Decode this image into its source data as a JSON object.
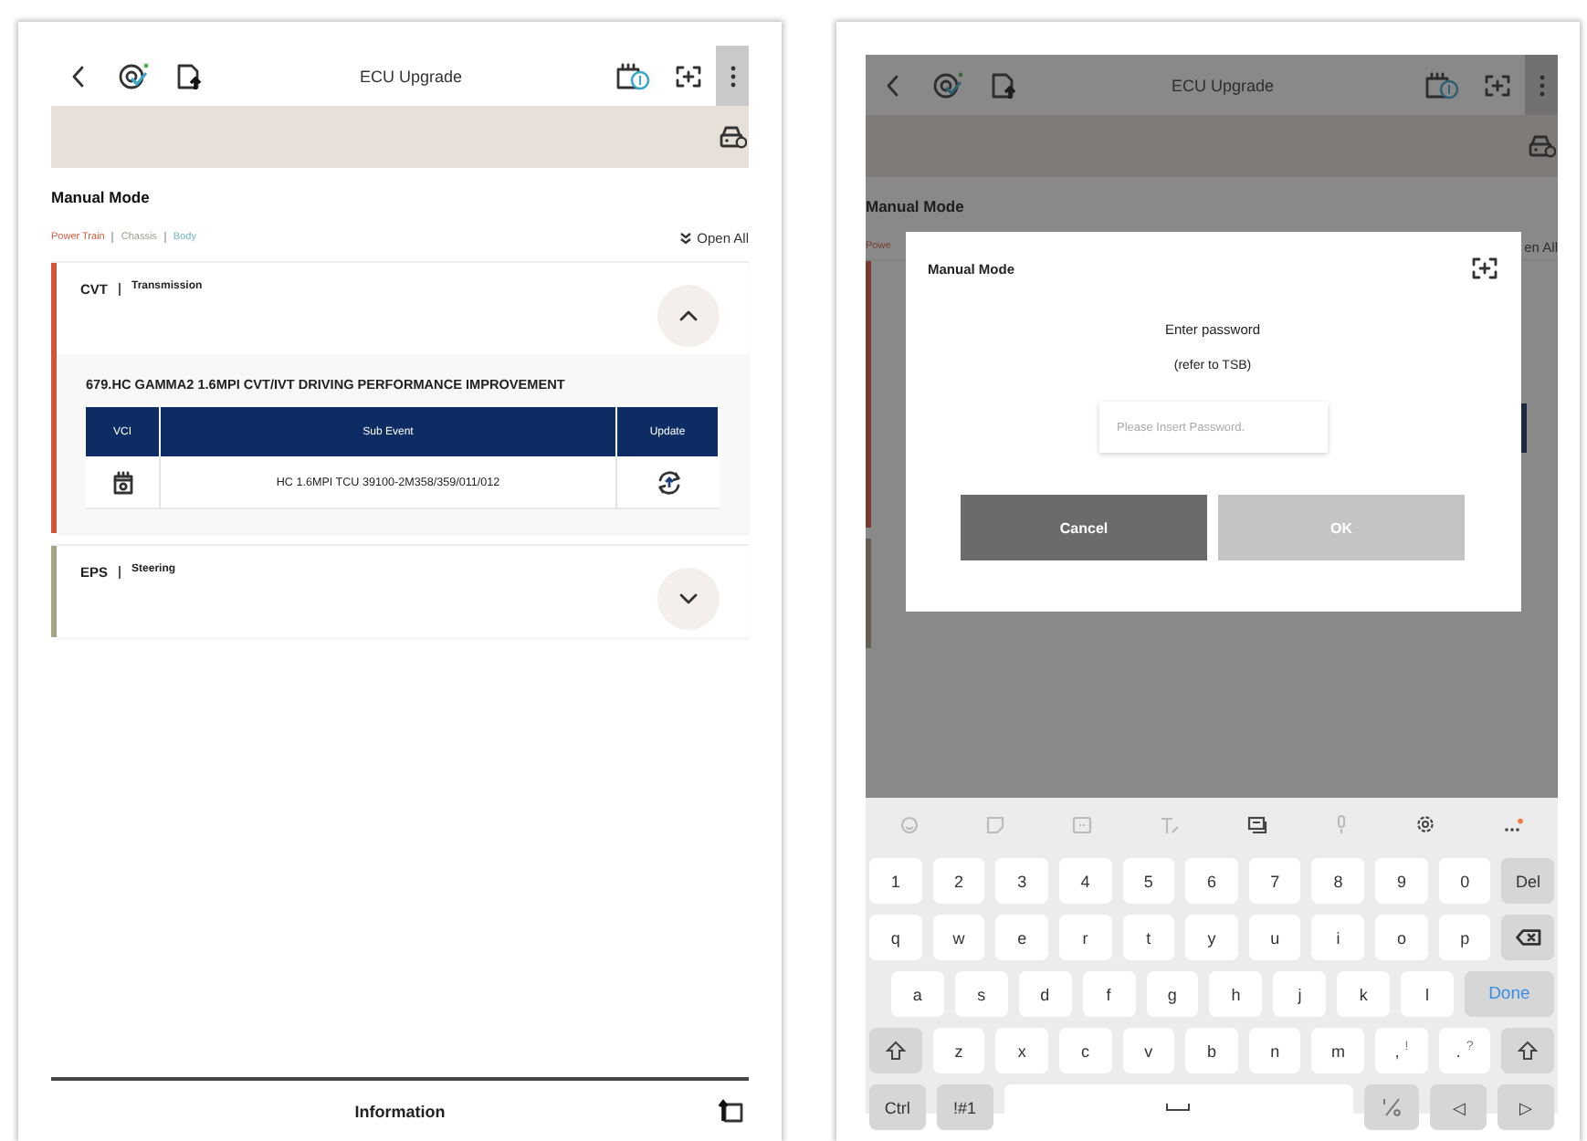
{
  "left_screen": {
    "header": {
      "title": "ECU Upgrade"
    },
    "page_title": "Manual Mode",
    "filters": [
      {
        "label": "Power Train",
        "color": "#d9593b"
      },
      {
        "label": "Chassis",
        "color": "#9c9f8c"
      },
      {
        "label": "Body",
        "color": "#79b6c6"
      }
    ],
    "open_all": "Open All",
    "groups": [
      {
        "code": "CVT",
        "name": "Transmission",
        "color": "#d4553a",
        "expanded": true,
        "event_title": "679.HC GAMMA2 1.6MPI CVT/IVT DRIVING PERFORMANCE IMPROVEMENT",
        "table": {
          "columns": [
            "VCI",
            "Sub Event",
            "Update"
          ],
          "rows": [
            {
              "sub_event": "HC 1.6MPI TCU 39100-2M358/359/011/012"
            }
          ]
        }
      },
      {
        "code": "EPS",
        "name": "Steering",
        "color": "#a6a485",
        "expanded": false
      }
    ],
    "footer": {
      "label": "Information"
    }
  },
  "right_screen": {
    "header": {
      "title": "ECU Upgrade"
    },
    "page_title": "Manual Mode",
    "filter_visible": "Powe",
    "open_all_visible": "en All",
    "dialog": {
      "title": "Manual Mode",
      "message": "Enter password",
      "note": "(refer to TSB)",
      "password": {
        "placeholder": "Please Insert Password."
      },
      "buttons": [
        {
          "label": "Cancel",
          "kind": "cancel",
          "disabled": false
        },
        {
          "label": "OK",
          "kind": "ok",
          "disabled": true
        }
      ]
    },
    "keyboard": {
      "rows": [
        {
          "keys": [
            {
              "label": "1",
              "kind": "char"
            },
            {
              "label": "2",
              "kind": "char"
            },
            {
              "label": "3",
              "kind": "char"
            },
            {
              "label": "4",
              "kind": "char"
            },
            {
              "label": "5",
              "kind": "char"
            },
            {
              "label": "6",
              "kind": "char"
            },
            {
              "label": "7",
              "kind": "char"
            },
            {
              "label": "8",
              "kind": "char"
            },
            {
              "label": "9",
              "kind": "char"
            },
            {
              "label": "0",
              "kind": "char"
            },
            {
              "label": "Del",
              "kind": "fn"
            }
          ]
        },
        {
          "keys": [
            {
              "label": "q",
              "kind": "char"
            },
            {
              "label": "w",
              "kind": "char"
            },
            {
              "label": "e",
              "kind": "char"
            },
            {
              "label": "r",
              "kind": "char"
            },
            {
              "label": "t",
              "kind": "char"
            },
            {
              "label": "y",
              "kind": "char"
            },
            {
              "label": "u",
              "kind": "char"
            },
            {
              "label": "i",
              "kind": "char"
            },
            {
              "label": "o",
              "kind": "char"
            },
            {
              "label": "p",
              "kind": "char"
            },
            {
              "kind": "backspace"
            }
          ]
        },
        {
          "keys": [
            {
              "label": "a",
              "kind": "char"
            },
            {
              "label": "s",
              "kind": "char"
            },
            {
              "label": "d",
              "kind": "char"
            },
            {
              "label": "f",
              "kind": "char"
            },
            {
              "label": "g",
              "kind": "char"
            },
            {
              "label": "h",
              "kind": "char"
            },
            {
              "label": "j",
              "kind": "char"
            },
            {
              "label": "k",
              "kind": "char"
            },
            {
              "label": "l",
              "kind": "char"
            },
            {
              "label": "Done",
              "kind": "done"
            }
          ]
        },
        {
          "keys": [
            {
              "kind": "shift"
            },
            {
              "label": "z",
              "kind": "char"
            },
            {
              "label": "x",
              "kind": "char"
            },
            {
              "label": "c",
              "kind": "char"
            },
            {
              "label": "v",
              "kind": "char"
            },
            {
              "label": "b",
              "kind": "char"
            },
            {
              "label": "n",
              "kind": "char"
            },
            {
              "label": "m",
              "kind": "char"
            },
            {
              "label": ",",
              "sub": "!",
              "kind": "char"
            },
            {
              "label": ".",
              "sub": "?",
              "kind": "char"
            },
            {
              "kind": "shift"
            }
          ]
        },
        {
          "keys": [
            {
              "label": "Ctrl",
              "kind": "fn"
            },
            {
              "label": "!#1",
              "kind": "fn"
            },
            {
              "kind": "space"
            },
            {
              "kind": "symbols"
            },
            {
              "label": "◁",
              "kind": "fn"
            },
            {
              "label": "▷",
              "kind": "fn"
            }
          ]
        }
      ]
    }
  }
}
